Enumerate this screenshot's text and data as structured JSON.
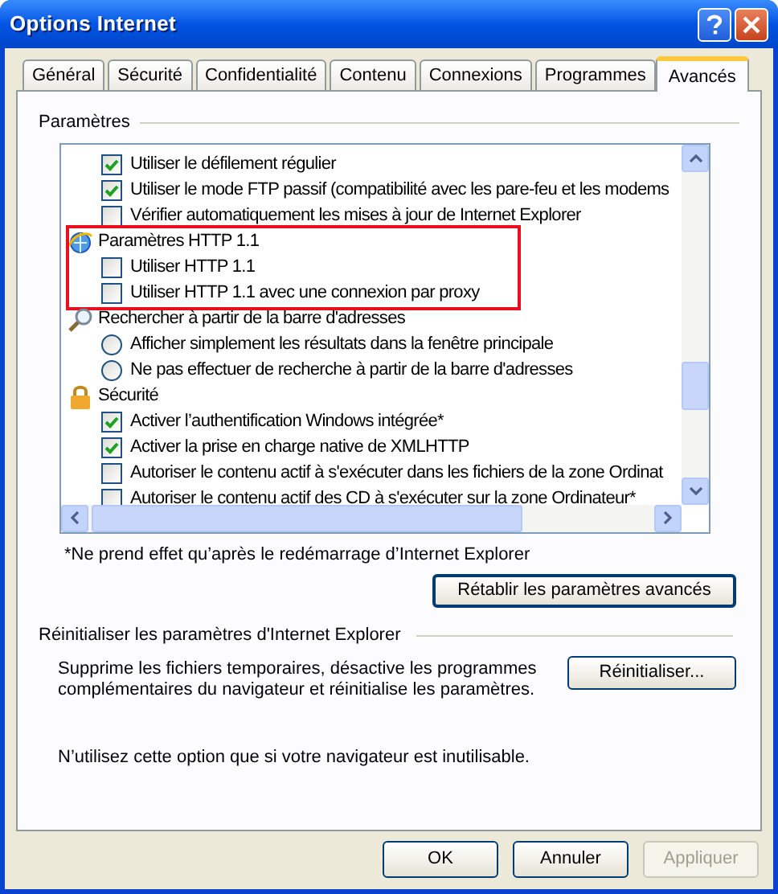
{
  "window": {
    "title": "Options Internet"
  },
  "tabs": [
    {
      "label": "Général",
      "selected": false
    },
    {
      "label": "Sécurité",
      "selected": false
    },
    {
      "label": "Confidentialité",
      "selected": false
    },
    {
      "label": "Contenu",
      "selected": false
    },
    {
      "label": "Connexions",
      "selected": false
    },
    {
      "label": "Programmes",
      "selected": false
    },
    {
      "label": "Avancés",
      "selected": true
    }
  ],
  "settings": {
    "legend": "Paramètres",
    "items": [
      {
        "kind": "checkbox",
        "label": "Utiliser le défilement régulier",
        "checked": true
      },
      {
        "kind": "checkbox",
        "label": "Utiliser le mode FTP passif (compatibilité avec les pare-feu et les modems",
        "checked": true
      },
      {
        "kind": "checkbox",
        "label": "Vérifier automatiquement les mises à jour de Internet Explorer",
        "checked": false
      },
      {
        "kind": "group",
        "label": "Paramètres HTTP 1.1",
        "highlighted": true,
        "children": [
          {
            "kind": "checkbox",
            "label": "Utiliser HTTP 1.1",
            "checked": false
          },
          {
            "kind": "checkbox",
            "label": "Utiliser HTTP 1.1 avec une connexion par proxy",
            "checked": false
          }
        ]
      },
      {
        "kind": "group",
        "label": "Rechercher à partir de la barre d'adresses",
        "highlighted": false,
        "children": [
          {
            "kind": "radio",
            "label": "Afficher simplement les résultats dans la fenêtre principale",
            "selected": false
          },
          {
            "kind": "radio",
            "label": "Ne pas effectuer de recherche à partir de la barre d'adresses",
            "selected": false
          }
        ]
      },
      {
        "kind": "group",
        "label": "Sécurité",
        "highlighted": false,
        "children": [
          {
            "kind": "checkbox",
            "label": "Activer l’authentification Windows intégrée*",
            "checked": true
          },
          {
            "kind": "checkbox",
            "label": "Activer la prise en charge native de XMLHTTP",
            "checked": true
          },
          {
            "kind": "checkbox",
            "label": "Autoriser le contenu actif à s'exécuter dans les fichiers de la zone Ordinat",
            "checked": false
          },
          {
            "kind": "checkbox",
            "label": "Autoriser le contenu actif des CD à s'exécuter sur la zone Ordinateur*",
            "checked": false
          }
        ]
      }
    ],
    "note": "*Ne prend effet qu’après le redémarrage d’Internet Explorer",
    "restore_button": "Rétablir les paramètres avancés"
  },
  "reset": {
    "legend": "Réinitialiser les paramètres d'Internet Explorer",
    "description": "Supprime les fichiers temporaires, désactive les programmes complémentaires du navigateur et réinitialise les paramètres.",
    "button": "Réinitialiser...",
    "warning": "N’utilisez cette option que si votre navigateur est inutilisable."
  },
  "buttons": [
    {
      "label": "OK",
      "disabled": false
    },
    {
      "label": "Annuler",
      "disabled": false
    },
    {
      "label": "Appliquer",
      "disabled": true
    }
  ]
}
